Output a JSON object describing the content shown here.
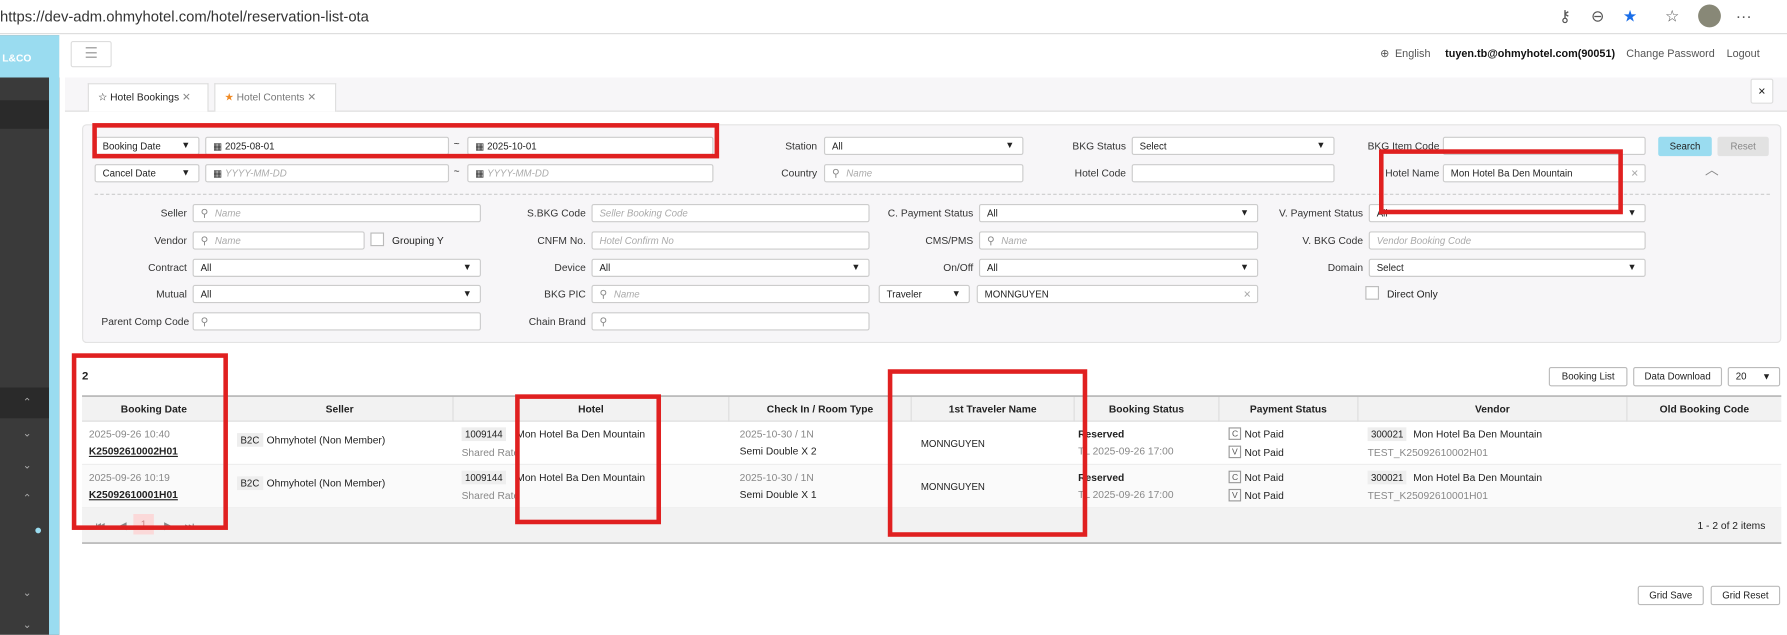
{
  "browser": {
    "url": "https://dev-adm.ohmyhotel.com/hotel/reservation-list-ota"
  },
  "sidebar": {
    "logo": "L&CO"
  },
  "header": {
    "language": "English",
    "user": "tuyen.tb@ohmyhotel.com(90051)",
    "change_password": "Change Password",
    "logout": "Logout"
  },
  "tabs": [
    {
      "label": "Hotel Bookings"
    },
    {
      "label": "Hotel Contents"
    }
  ],
  "filters": {
    "date_type": "Booking Date",
    "date_from": "2025-08-01",
    "date_to": "2025-10-01",
    "cancel_type": "Cancel Date",
    "date_placeholder": "YYYY-MM-DD",
    "tilde": "~",
    "station_label": "Station",
    "station": "All",
    "bkg_status_label": "BKG Status",
    "bkg_status": "Select",
    "bkg_item_code_label": "BKG Item Code",
    "country_label": "Country",
    "name_placeholder": "Name",
    "hotel_code_label": "Hotel Code",
    "hotel_name_label": "Hotel Name",
    "hotel_name": "Mon Hotel Ba Den Mountain",
    "seller_label": "Seller",
    "sbkg_label": "S.BKG Code",
    "sbkg_placeholder": "Seller Booking Code",
    "cpay_label": "C. Payment Status",
    "cpay": "All",
    "vpay_label": "V. Payment Status",
    "vpay": "All",
    "vendor_label": "Vendor",
    "grouping": "Grouping Y",
    "cnfm_label": "CNFM No.",
    "cnfm_placeholder": "Hotel Confirm No",
    "cms_label": "CMS/PMS",
    "vbkg_label": "V. BKG Code",
    "vbkg_placeholder": "Vendor Booking Code",
    "contract_label": "Contract",
    "contract": "All",
    "device_label": "Device",
    "device": "All",
    "onoff_label": "On/Off",
    "onoff": "All",
    "domain_label": "Domain",
    "domain": "Select",
    "mutual_label": "Mutual",
    "mutual": "All",
    "bkgpic_label": "BKG PIC",
    "traveler_type": "Traveler",
    "traveler": "MONNGUYEN",
    "direct_only": "Direct Only",
    "parent_label": "Parent Comp Code",
    "chain_label": "Chain Brand",
    "search": "Search",
    "reset": "Reset"
  },
  "results": {
    "count": "2",
    "booking_list": "Booking List",
    "data_download": "Data Download",
    "page_size": "20",
    "columns": [
      "Booking Date",
      "Seller",
      "Hotel",
      "Check In / Room Type",
      "1st Traveler Name",
      "Booking Status",
      "Payment Status",
      "Vendor",
      "Old Booking Code"
    ],
    "rows": [
      {
        "date": "2025-09-26 10:40",
        "code": "K25092610002H01",
        "seller_type": "B2C",
        "seller": "Ohmyhotel (Non Member)",
        "hotel_code": "1009144",
        "hotel": "Mon Hotel Ba Den Mountain",
        "rate": "Shared Rate",
        "checkin": "2025-10-30 / 1N",
        "room": "Semi Double X 2",
        "traveler": "MONNGUYEN",
        "status": "Reserved",
        "tl": "TL 2025-09-26 17:00",
        "c": "C",
        "v": "V",
        "c_pay": "Not Paid",
        "v_pay": "Not Paid",
        "vendor_code": "300021",
        "vendor": "Mon Hotel Ba Den Mountain",
        "vendor_ref": "TEST_K25092610002H01"
      },
      {
        "date": "2025-09-26 10:19",
        "code": "K25092610001H01",
        "seller_type": "B2C",
        "seller": "Ohmyhotel (Non Member)",
        "hotel_code": "1009144",
        "hotel": "Mon Hotel Ba Den Mountain",
        "rate": "Shared Rate",
        "checkin": "2025-10-30 / 1N",
        "room": "Semi Double X 1",
        "traveler": "MONNGUYEN",
        "status": "Reserved",
        "tl": "TL 2025-09-26 17:00",
        "c": "C",
        "v": "V",
        "c_pay": "Not Paid",
        "v_pay": "Not Paid",
        "vendor_code": "300021",
        "vendor": "Mon Hotel Ba Den Mountain",
        "vendor_ref": "TEST_K25092610001H01"
      }
    ],
    "page": "1",
    "summary": "1 - 2 of 2 items",
    "grid_save": "Grid Save",
    "grid_reset": "Grid Reset"
  },
  "colors": {
    "accent": "#9adcf0",
    "annotation": "#e02020",
    "sidebar": "#3a3a3a"
  }
}
